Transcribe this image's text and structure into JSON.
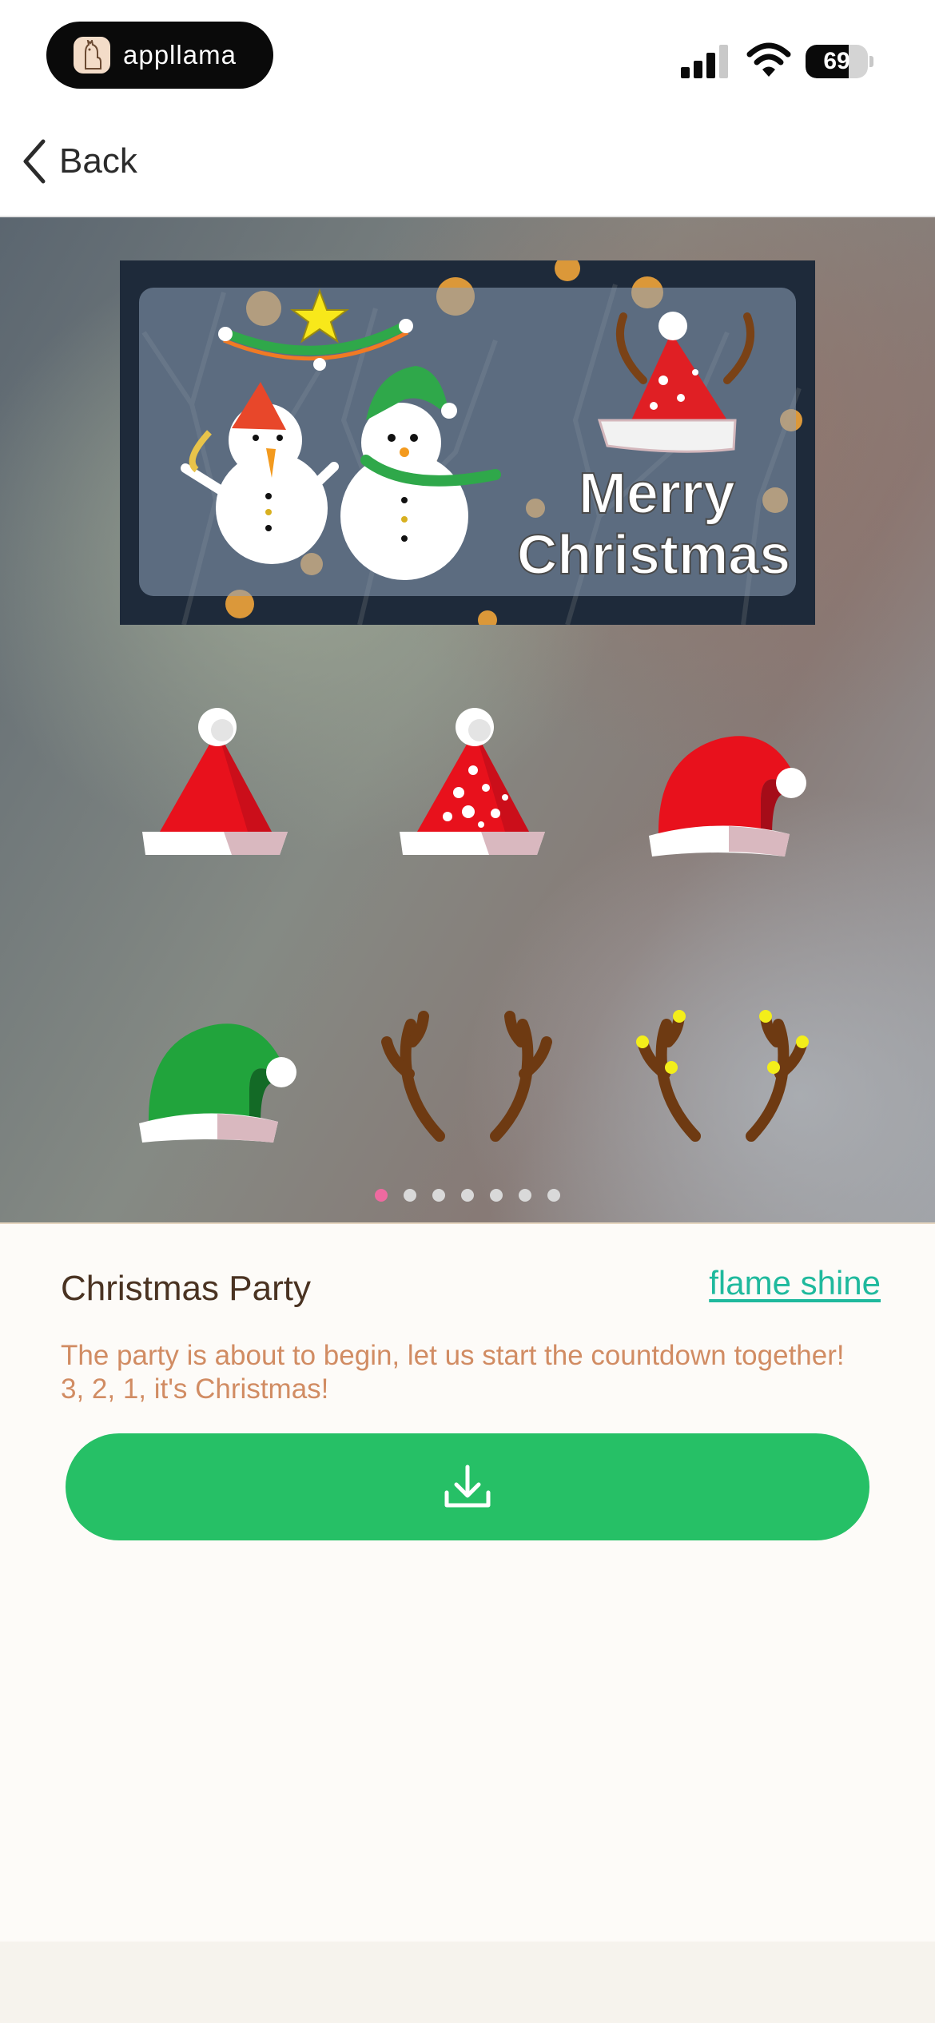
{
  "status_bar": {
    "app_name": "appllama",
    "battery_level": "69",
    "battery_fraction": 0.69,
    "icons": [
      "llama-logo-icon",
      "cellular-signal-icon",
      "wifi-icon",
      "battery-icon"
    ]
  },
  "nav": {
    "back_label": "Back",
    "back_icon": "chevron-left-icon"
  },
  "preview": {
    "banner_text_line1": "Merry",
    "banner_text_line2": "Christmas",
    "stickers": [
      "santa-hat-icon",
      "polka-dot-santa-hat-icon",
      "slouch-santa-hat-icon",
      "elf-hat-icon",
      "antlers-icon",
      "lit-antlers-icon"
    ],
    "page_count": 7,
    "active_page": 1,
    "dot_colors": {
      "active": "#ee6aa0",
      "inactive": "#d9d9d9"
    }
  },
  "pack": {
    "title": "Christmas Party",
    "author": "flame shine",
    "description": "The party is about to begin, let us start the countdown together! 3, 2, 1, it's Christmas!",
    "download_icon": "download-icon"
  },
  "colors": {
    "accent_green": "#26c066",
    "author_link": "#1fb99d",
    "description_text": "#d18c63",
    "title_text": "#4a3322"
  }
}
